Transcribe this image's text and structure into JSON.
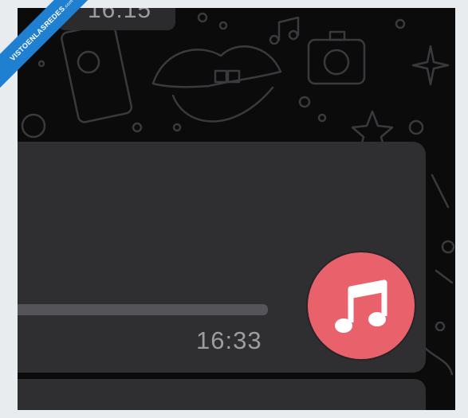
{
  "watermark": {
    "text": "VISTOENLASREDES",
    "suffix": ".com"
  },
  "previous_message": {
    "time": "16:15"
  },
  "audio_message": {
    "time": "16:33",
    "icon": "music-note-icon",
    "button_color": "#e9626b",
    "bubble_color": "#2f2f32"
  },
  "wallpaper": {
    "color": "#0b0b0c",
    "pattern": "doodles"
  }
}
